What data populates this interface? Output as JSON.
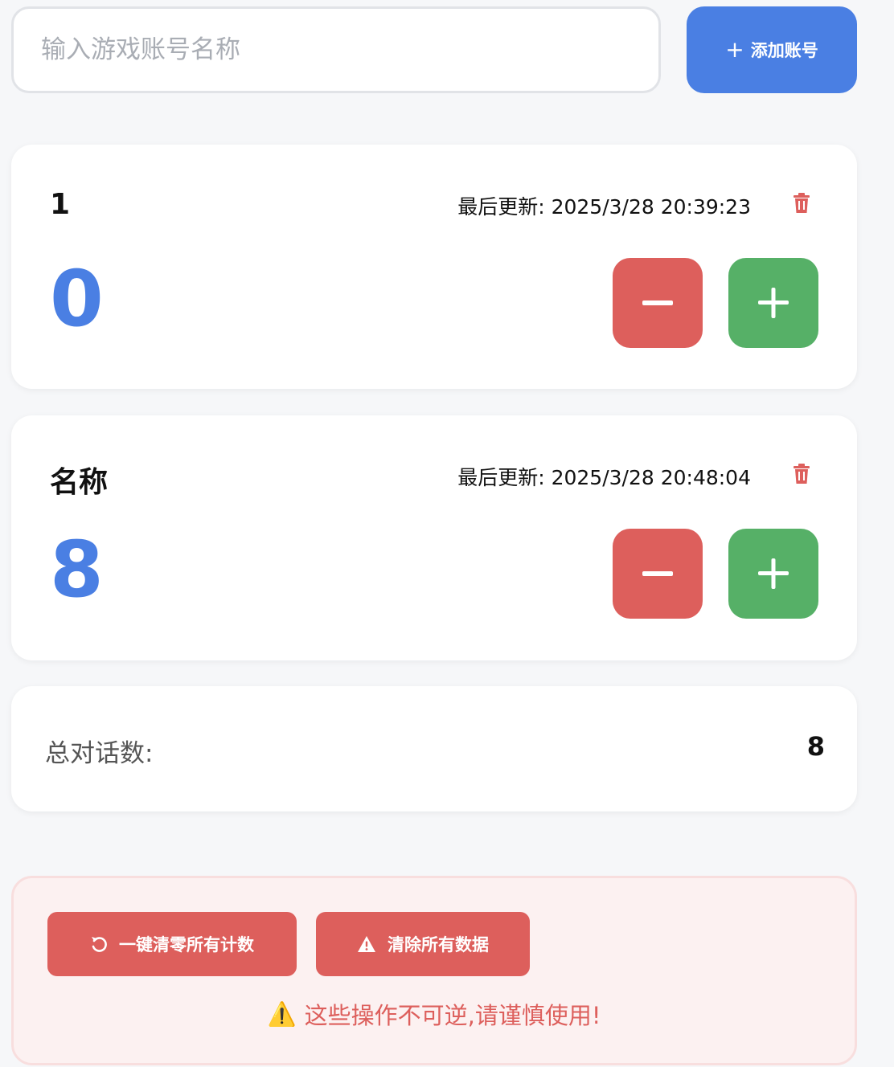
{
  "add_account": {
    "placeholder": "输入游戏账号名称",
    "value": "",
    "button_label": "添加账号",
    "button_icon": "plus-icon"
  },
  "accounts": [
    {
      "name": "1",
      "updated_label": "最后更新:",
      "updated_time": "2025/3/28 20:39:23",
      "count": "0"
    },
    {
      "name": "名称",
      "updated_label": "最后更新:",
      "updated_time": "2025/3/28 20:48:04",
      "count": "8"
    }
  ],
  "total": {
    "label": "总对话数:",
    "value": "8"
  },
  "danger": {
    "reset_label": "一键清零所有计数",
    "clear_label": "清除所有数据",
    "warning": "这些操作不可逆,请谨慎使用!",
    "warning_icon": "⚠️"
  },
  "colors": {
    "primary": "#4a7fe3",
    "danger": "#dd5f5c",
    "success": "#56b067",
    "background": "#f6f7f9"
  }
}
